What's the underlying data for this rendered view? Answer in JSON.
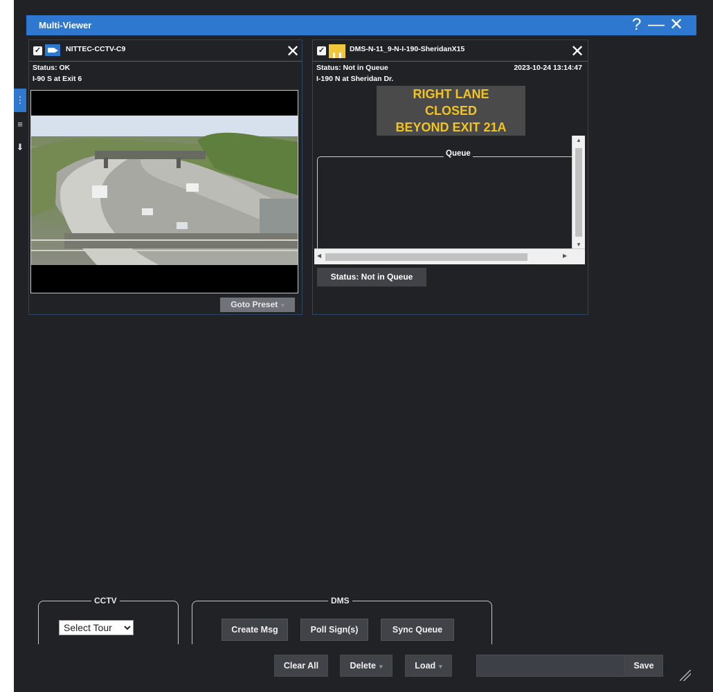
{
  "window": {
    "title": "Multi-Viewer",
    "help_icon": "?",
    "minimize_icon": "—",
    "close_icon": "✕",
    "accent_color": "#2e78cf"
  },
  "side_tabs": [
    {
      "icon": "dots-vertical-icon",
      "glyph": "⋮",
      "active": true
    },
    {
      "icon": "list-icon",
      "glyph": "≡",
      "active": false
    },
    {
      "icon": "arrow-icon",
      "glyph": "⬇",
      "active": false
    }
  ],
  "cctv_panel": {
    "checked": true,
    "icon": "camera-icon",
    "name": "NITTEC-CCTV-C9",
    "status": "Status: OK",
    "location": "I-90 S at Exit 6",
    "close_icon": "✕",
    "goto_preset_label": "Goto Preset"
  },
  "dms_panel": {
    "checked": true,
    "icon": "sign-icon",
    "name": "DMS-N-11_9-N-I-190-SheridanX15",
    "status": "Status: Not in Queue",
    "timestamp": "2023-10-24 13:14:47",
    "location": "I-190 N at Sheridan Dr.",
    "close_icon": "✕",
    "message_lines": [
      "RIGHT LANE",
      "CLOSED",
      "BEYOND EXIT 21A"
    ],
    "message_color": "#f3c41f",
    "queue_label": "Queue",
    "queue_status": "Status: Not in Queue"
  },
  "cctv_group": {
    "legend": "CCTV",
    "select_value": "Select Tour"
  },
  "dms_group": {
    "legend": "DMS",
    "buttons": [
      "Create Msg",
      "Poll Sign(s)",
      "Sync Queue"
    ]
  },
  "toolbar": {
    "clear_all": "Clear All",
    "delete": "Delete",
    "load": "Load",
    "name_value": "",
    "save": "Save"
  }
}
